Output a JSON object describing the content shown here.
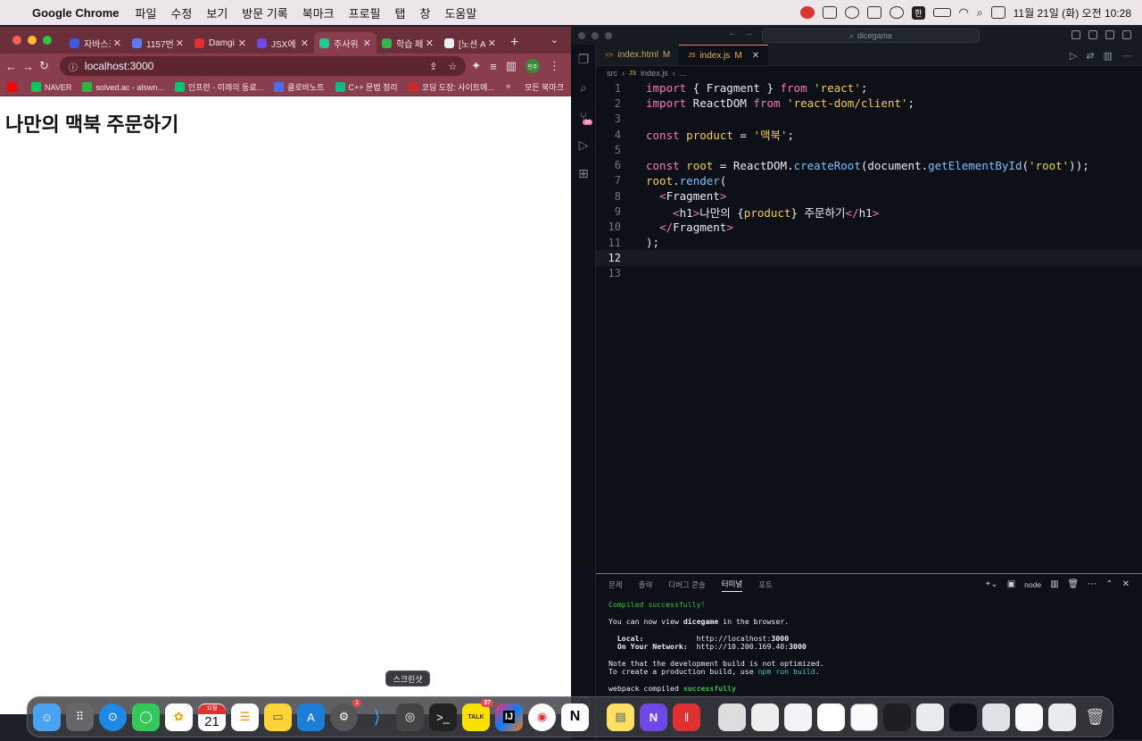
{
  "menubar": {
    "app_name": "Google Chrome",
    "items": [
      "파일",
      "수정",
      "보기",
      "방문 기록",
      "북마크",
      "프로필",
      "탭",
      "창",
      "도움말"
    ],
    "clock": "11월 21일 (화) 오전 10:28",
    "input_source": "한"
  },
  "browser": {
    "tabs": [
      {
        "title": "자바스크",
        "color": "#3b5bdb"
      },
      {
        "title": "1157번",
        "color": "#5c7cfa"
      },
      {
        "title": "Damgi",
        "color": "#e03131"
      },
      {
        "title": "JSX에",
        "color": "#7048e8"
      },
      {
        "title": "주사위",
        "color": "#20c997"
      },
      {
        "title": "학습 페",
        "color": "#37b24d"
      },
      {
        "title": "[노션 A",
        "color": "#eeeeee"
      }
    ],
    "active_tab_index": 4,
    "url": "localhost:3000",
    "profile_initials": "민주",
    "bookmarks": [
      {
        "label": "",
        "color": "#ff0000"
      },
      {
        "label": "NAVER",
        "color": "#03c75a"
      },
      {
        "label": "solved.ac - alswn...",
        "color": "#2fb344"
      },
      {
        "label": "인프런 - 미래의 동료...",
        "color": "#00c471"
      },
      {
        "label": "클로바노트",
        "color": "#4c6ef5"
      },
      {
        "label": "C++ 문법 정리",
        "color": "#12b886"
      },
      {
        "label": "코딩 도장: 사이트에...",
        "color": "#c92a2a"
      }
    ],
    "bookmarks_more": "»",
    "all_bookmarks": "모든 북마크",
    "page_heading": "나만의 맥북 주문하기"
  },
  "vscode": {
    "search_text": "dicegame",
    "tabs": [
      {
        "label": "index.html",
        "status": "M",
        "icon": "html-icon"
      },
      {
        "label": "index.js",
        "status": "M",
        "icon": "js-icon"
      }
    ],
    "breadcrumb": [
      "src",
      "index.js",
      "..."
    ],
    "current_line": 12,
    "code_lines": [
      "import { Fragment } from 'react';",
      "import ReactDOM from 'react-dom/client';",
      "",
      "const product = '맥북';",
      "",
      "const root = ReactDOM.createRoot(document.getElementById('root'));",
      "root.render(",
      "  <Fragment>",
      "    <h1>나만의 {product} 주문하기</h1>",
      "  </Fragment>",
      ");",
      "",
      ""
    ],
    "source_control_badge": "14",
    "panel": {
      "tabs": [
        "문제",
        "출력",
        "디버그 콘솔",
        "터미널",
        "포트"
      ],
      "active_tab": "터미널",
      "shell": "node",
      "terminal": {
        "compiled": "Compiled successfully!",
        "view_prefix": "You can now view ",
        "app": "dicegame",
        "view_suffix": " in the browser.",
        "local_label": "Local:",
        "local_url_prefix": "http://localhost:",
        "local_port": "3000",
        "network_label": "On Your Network:",
        "network_url_prefix": "http://10.200.169.40:",
        "network_port": "3000",
        "note1": "Note that the development build is not optimized.",
        "note2_prefix": "To create a production build, use ",
        "note2_cmd": "npm run build",
        "note2_suffix": ".",
        "webpack_prefix": "webpack compiled ",
        "webpack_status": "successfully"
      }
    }
  },
  "dock": {
    "tooltip": "스크린샷",
    "system_settings_badge": "1",
    "kakaotalk_badge": "37",
    "calendar_month": "11월",
    "calendar_day": "21",
    "kakao_label": "TALK",
    "intellij_label": "IJ"
  }
}
